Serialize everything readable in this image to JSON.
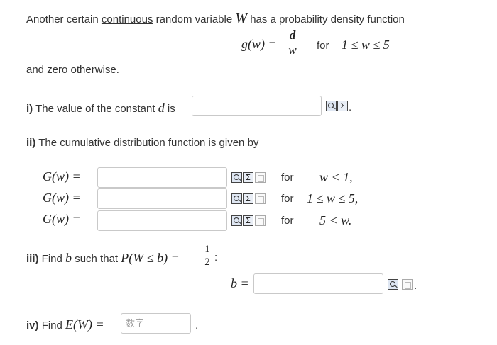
{
  "intro": {
    "prefix": "Another certain",
    "underlined": "continuous",
    "middle": "random variable",
    "var": "W",
    "suffix": "has a probability density function"
  },
  "pdf": {
    "lhs": "g(w) =",
    "numerator": "d",
    "denominator": "w",
    "for_word": "for",
    "range": "1 ≤ w ≤ 5"
  },
  "zero_otherwise": "and zero otherwise.",
  "q1": {
    "label": "i)",
    "text": "The value of the constant",
    "var": "d",
    "is": "is",
    "value": ""
  },
  "q2": {
    "label": "ii)",
    "text": "The cumulative distribution function is given by",
    "rows": [
      {
        "lhs": "G(w) =",
        "for": "for",
        "cond": "w < 1,",
        "value": ""
      },
      {
        "lhs": "G(w) =",
        "for": "for",
        "cond": "1 ≤ w ≤ 5,",
        "value": ""
      },
      {
        "lhs": "G(w) =",
        "for": "for",
        "cond": "5 < w.",
        "value": ""
      }
    ]
  },
  "q3": {
    "label": "iii)",
    "text": "Find",
    "var": "b",
    "text2": "such that",
    "expr": "P(W ≤ b) =",
    "numerator": "1",
    "denominator": "2",
    "answer_lhs": "b =",
    "value": ""
  },
  "q4": {
    "label": "iv)",
    "text": "Find",
    "expr": "E(W) =",
    "placeholder": "数字",
    "value": ""
  },
  "icons": {
    "preview": "preview-icon",
    "equation": "equation-editor-icon",
    "help": "help-icon",
    "equation_glyph": "Σ"
  }
}
